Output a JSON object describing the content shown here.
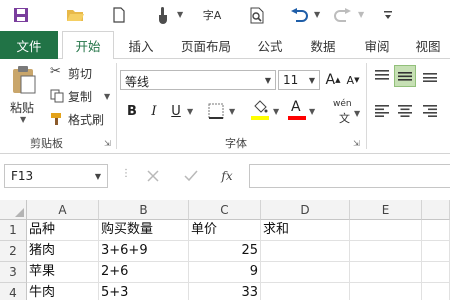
{
  "qat": {
    "icons": [
      "save-icon",
      "open-folder-icon",
      "new-document-icon",
      "touch-mode-icon",
      "spelling-icon",
      "print-preview-icon",
      "undo-icon",
      "redo-icon",
      "customize-icon"
    ],
    "spelling_glyph": "字A"
  },
  "tabs": {
    "file": "文件",
    "items": [
      "开始",
      "插入",
      "页面布局",
      "公式",
      "数据",
      "审阅",
      "视图"
    ]
  },
  "clipboard": {
    "paste": "粘贴",
    "cut": "剪切",
    "copy": "复制",
    "format_painter": "格式刷",
    "group_label": "剪贴板"
  },
  "font": {
    "name": "等线",
    "size": "11",
    "bold": "B",
    "italic": "I",
    "underline": "U",
    "grow": "A",
    "shrink": "A",
    "font_color_letter": "A",
    "phonetic": "wén",
    "group_label": "字体"
  },
  "formula_bar": {
    "name_box": "F13",
    "fx": "fx",
    "value": ""
  },
  "sheet": {
    "columns": [
      "A",
      "B",
      "C",
      "D",
      "E"
    ],
    "rows": [
      {
        "num": "1",
        "A": "品种",
        "B": "购买数量",
        "C": "单价",
        "D": "求和",
        "E": ""
      },
      {
        "num": "2",
        "A": "猪肉",
        "B": "3+6+9",
        "C": "25",
        "D": "",
        "E": ""
      },
      {
        "num": "3",
        "A": "苹果",
        "B": "2+6",
        "C": "9",
        "D": "",
        "E": ""
      },
      {
        "num": "4",
        "A": "牛肉",
        "B": "5+3",
        "C": "33",
        "D": "",
        "E": ""
      }
    ]
  },
  "colors": {
    "excel_green": "#217346",
    "highlight_yellow": "#ffff00",
    "font_red": "#ff0000",
    "active_align": "#c6e0b4"
  }
}
